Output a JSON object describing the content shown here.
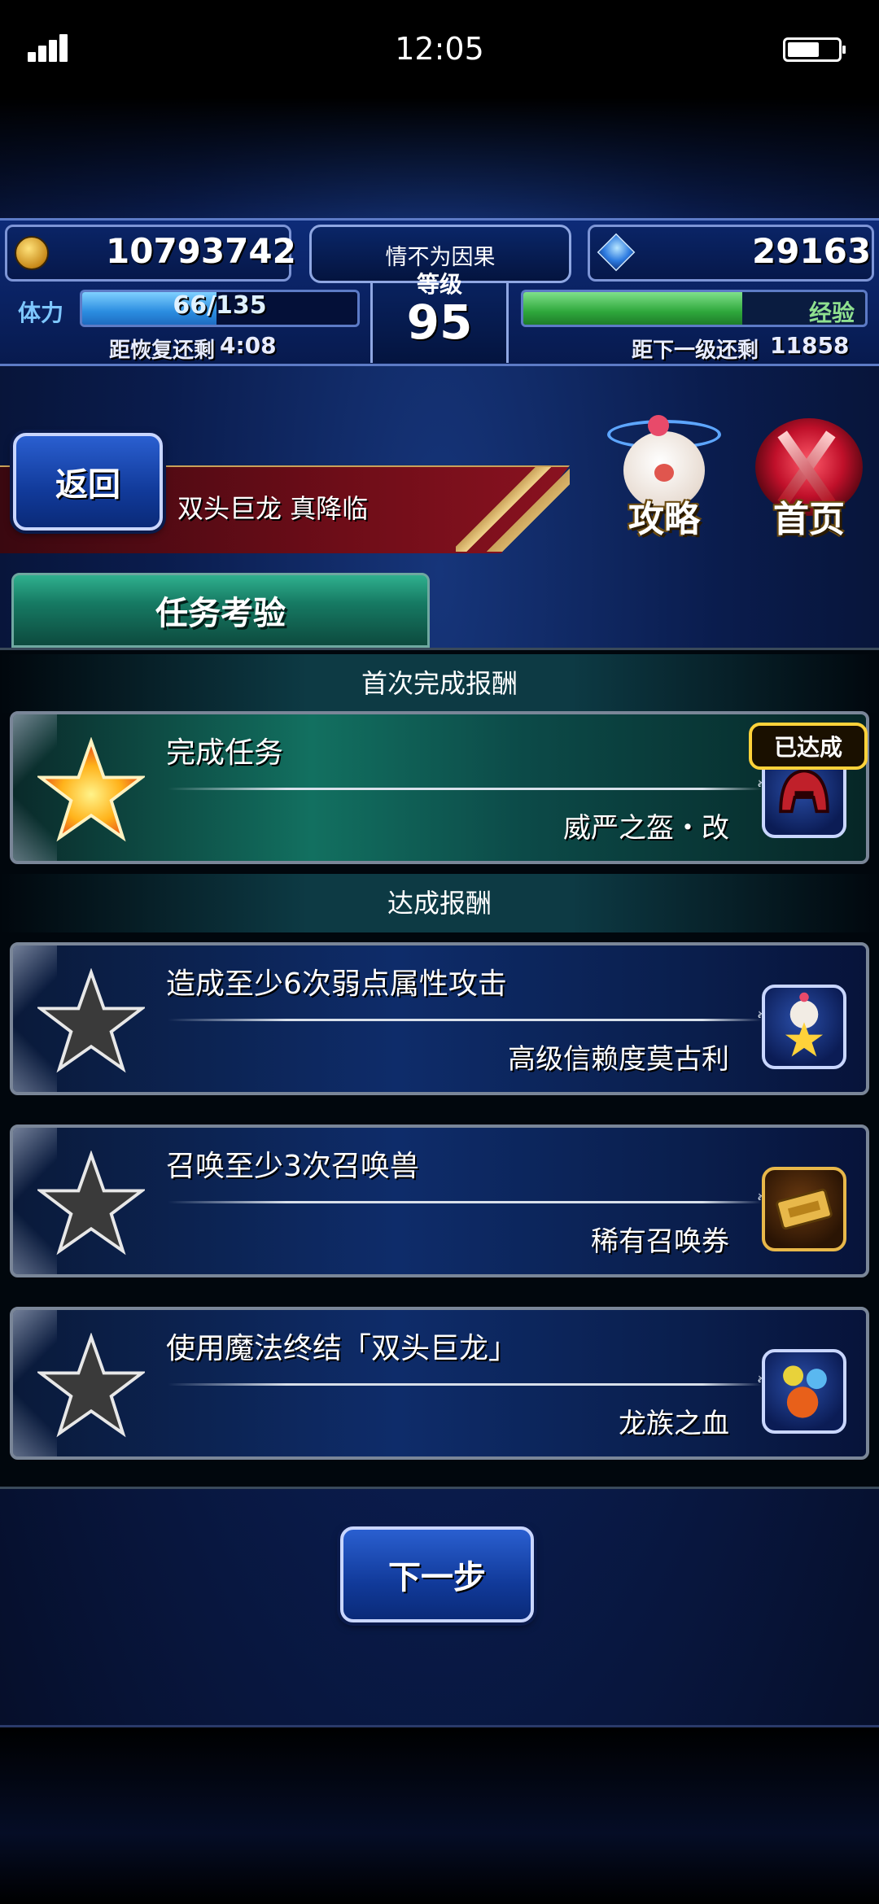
{
  "status_bar": {
    "time": "12:05",
    "signal_icon": "signal-icon",
    "battery_icon": "battery-icon"
  },
  "header": {
    "gil": "10793742",
    "gems": "29163",
    "team_name": "情不为因果",
    "level_label": "等级",
    "level": "95",
    "stamina_label": "体力",
    "stamina_text": "66/135",
    "stamina_fraction": 0.489,
    "recover_label": "距恢复还剩",
    "recover_time": "4:08",
    "exp_label": "经验",
    "exp_fraction": 0.64,
    "next_level_label": "距下一级还剩",
    "next_level_value": "11858"
  },
  "nav": {
    "back_label": "返回",
    "quest_title": "双头巨龙 真降临",
    "guide_label": "攻略",
    "home_label": "首页"
  },
  "tab": {
    "label": "任务考验"
  },
  "sections": {
    "first_clear": "首次完成报酬",
    "achievements": "达成报酬"
  },
  "missions": [
    {
      "text": "完成任务",
      "reward": "威严之盔・改",
      "status": "已达成",
      "achieved": true,
      "star_icon": "gold-star-icon",
      "reward_icon": "helmet-icon"
    },
    {
      "text": "造成至少6次弱点属性攻击",
      "reward": "高级信赖度莫古利",
      "achieved": false,
      "star_icon": "grey-star-icon",
      "reward_icon": "moogle-icon"
    },
    {
      "text": "召唤至少3次召唤兽",
      "reward": "稀有召唤券",
      "achieved": false,
      "star_icon": "grey-star-icon",
      "reward_icon": "ticket-icon"
    },
    {
      "text": "使用魔法终结「双头巨龙」",
      "reward": "龙族之血",
      "achieved": false,
      "star_icon": "grey-star-icon",
      "reward_icon": "orbs-icon"
    }
  ],
  "footer": {
    "next_label": "下一步"
  },
  "colors": {
    "accent_blue": "#113a9a",
    "done_teal": "#127060",
    "badge_gold": "#ffd23a"
  }
}
